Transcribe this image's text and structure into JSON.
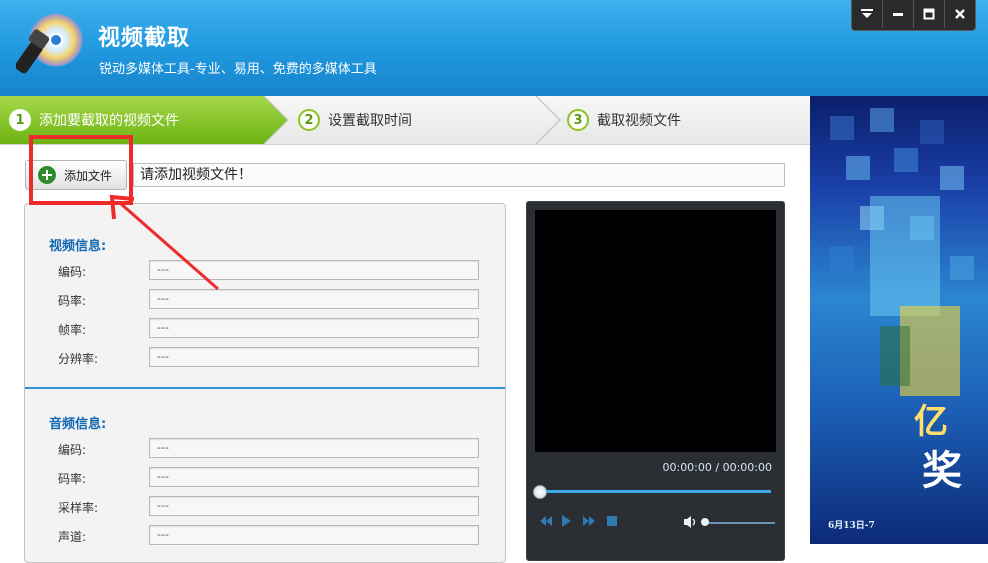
{
  "app": {
    "title": "视频截取",
    "subtitle": "锐动多媒体工具-专业、易用、免费的多媒体工具"
  },
  "window_controls": [
    "menu-icon",
    "minimize-icon",
    "maximize-icon",
    "close-icon"
  ],
  "steps": [
    {
      "num": "1",
      "label": "添加要截取的视频文件",
      "active": true
    },
    {
      "num": "2",
      "label": "设置截取时间",
      "active": false
    },
    {
      "num": "3",
      "label": "截取视频文件",
      "active": false
    }
  ],
  "toolbar": {
    "add_label": "添加文件",
    "path_text": "请添加视频文件！"
  },
  "video_info": {
    "title": "视频信息:",
    "fields": [
      {
        "label": "编码:",
        "value": "---"
      },
      {
        "label": "码率:",
        "value": "---"
      },
      {
        "label": "帧率:",
        "value": "---"
      },
      {
        "label": "分辨率:",
        "value": "---"
      }
    ]
  },
  "audio_info": {
    "title": "音频信息:",
    "fields": [
      {
        "label": "编码:",
        "value": "---"
      },
      {
        "label": "码率:",
        "value": "---"
      },
      {
        "label": "采样率:",
        "value": "---"
      },
      {
        "label": "声道:",
        "value": "---"
      }
    ]
  },
  "player": {
    "time": "00:00:00 / 00:00:00",
    "progress": 0,
    "volume": 0
  },
  "ad": {
    "big": "亿",
    "bottom": "奖",
    "caption": "6月13日-7"
  },
  "colors": {
    "header": "#1e95dc",
    "step_active": "#7dc21a",
    "accent_blue": "#1368b4",
    "annotation_red": "#ee2a2a"
  }
}
